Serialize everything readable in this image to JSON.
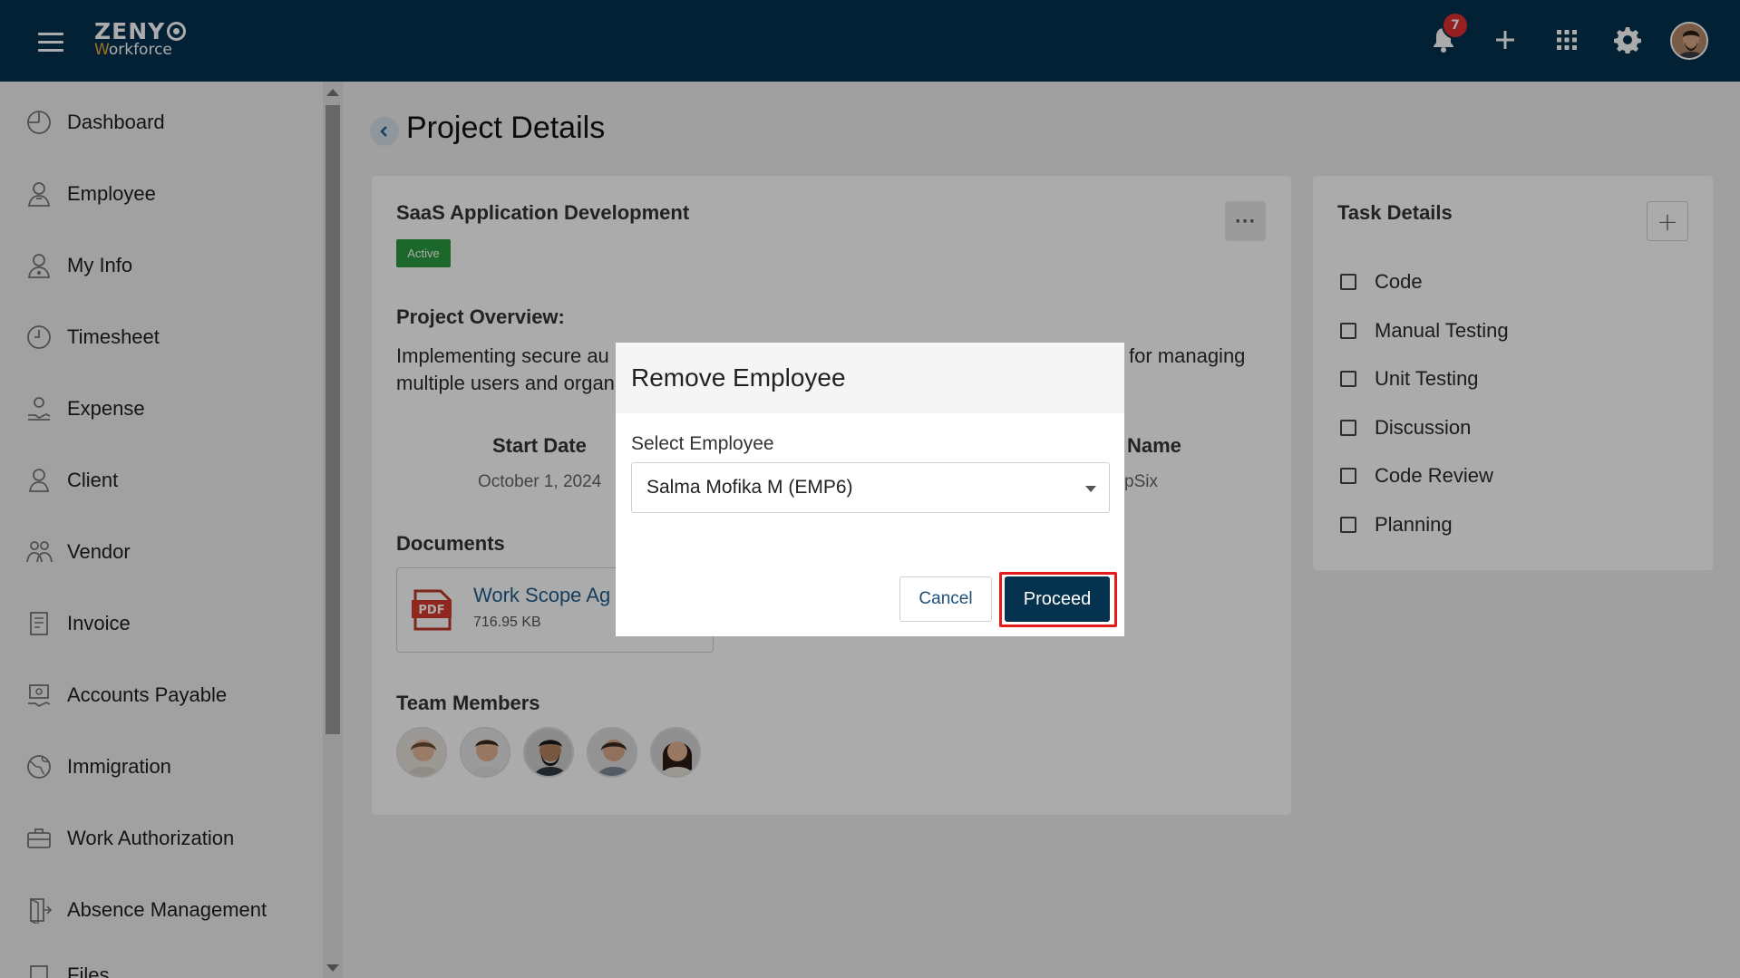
{
  "app": {
    "logo_top": "ZENY",
    "logo_bottom_first": "W",
    "logo_bottom_rest": "orkforce",
    "notification_count": "7",
    "colors": {
      "topbar": "#04324f",
      "accent": "#f2a72c",
      "active": "#2b9b3f",
      "highlight": "#e21b1b"
    }
  },
  "topbar": {
    "icons": [
      "menu-icon",
      "bell-icon",
      "plus-icon",
      "apps-grid-icon",
      "gear-icon",
      "user-avatar"
    ]
  },
  "sidebar": {
    "items": [
      {
        "label": "Dashboard",
        "icon": "dashboard-icon"
      },
      {
        "label": "Employee",
        "icon": "employee-icon"
      },
      {
        "label": "My Info",
        "icon": "my-info-icon"
      },
      {
        "label": "Timesheet",
        "icon": "clock-icon"
      },
      {
        "label": "Expense",
        "icon": "expense-icon"
      },
      {
        "label": "Client",
        "icon": "client-icon"
      },
      {
        "label": "Vendor",
        "icon": "vendor-icon"
      },
      {
        "label": "Invoice",
        "icon": "invoice-icon"
      },
      {
        "label": "Accounts Payable",
        "icon": "accounts-payable-icon"
      },
      {
        "label": "Immigration",
        "icon": "globe-icon"
      },
      {
        "label": "Work Authorization",
        "icon": "briefcase-icon"
      },
      {
        "label": "Absence Management",
        "icon": "door-icon"
      },
      {
        "label": "Files",
        "icon": "files-icon"
      }
    ]
  },
  "page": {
    "title": "Project Details"
  },
  "project": {
    "name": "SaaS Application Development",
    "status": "Active",
    "overview_heading": "Project Overview:",
    "overview_left_1": "Implementing secure au",
    "overview_right_1": "for managing",
    "overview_left_2": "multiple users and organ",
    "start_date_label": "Start Date",
    "start_date_value": "October 1, 2024",
    "client_label": "Name",
    "client_value": "pSix",
    "documents_heading": "Documents",
    "document": {
      "name": "Work Scope Ag",
      "size": "716.95 KB",
      "icon": "pdf-icon",
      "icon_text": "PDF"
    },
    "team_heading": "Team Members",
    "team_count": 5
  },
  "tasks": {
    "title": "Task Details",
    "add_icon": "plus-icon",
    "items": [
      "Code",
      "Manual Testing",
      "Unit Testing",
      "Discussion",
      "Code Review",
      "Planning"
    ]
  },
  "modal": {
    "title": "Remove Employee",
    "select_label": "Select Employee",
    "select_value": "Salma Mofika M (EMP6)",
    "cancel_label": "Cancel",
    "proceed_label": "Proceed"
  }
}
